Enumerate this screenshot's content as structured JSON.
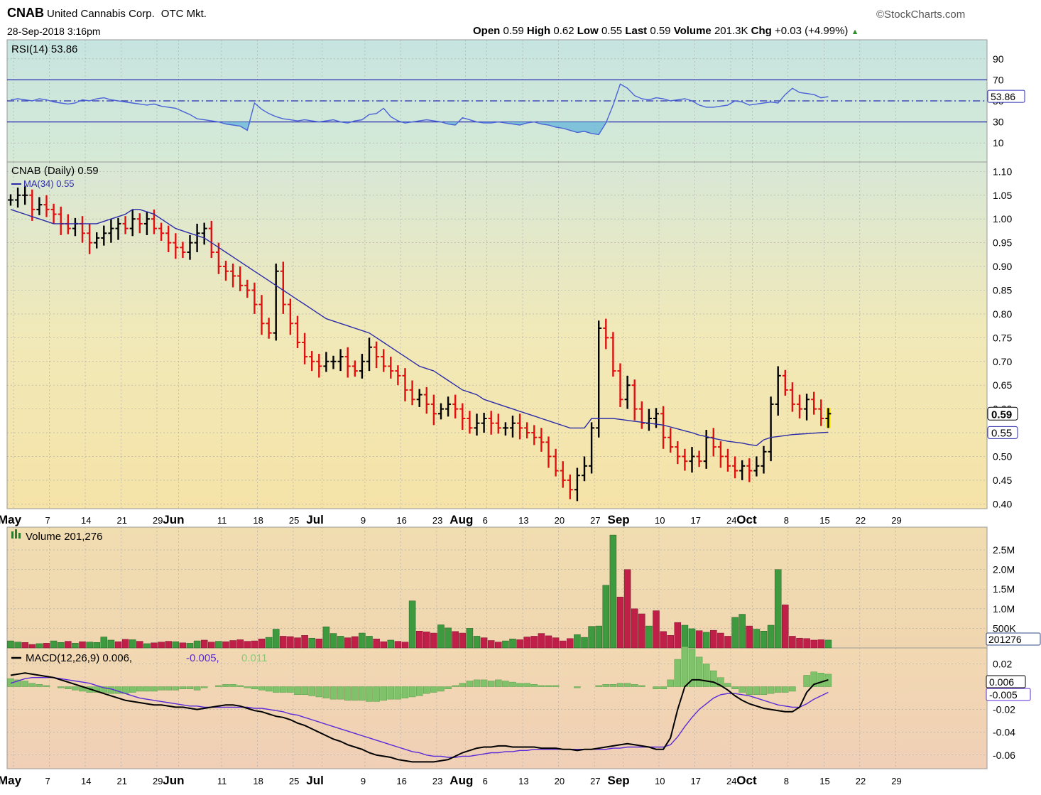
{
  "header": {
    "symbol": "CNAB",
    "company": "United Cannabis Corp.",
    "exchange": "OTC Mkt.",
    "datetime": "28-Sep-2018 3:16pm",
    "brand": "©StockCharts.com",
    "open_label": "Open",
    "open": "0.59",
    "high_label": "High",
    "high": "0.62",
    "low_label": "Low",
    "low": "0.55",
    "last_label": "Last",
    "last": "0.59",
    "volume_label": "Volume",
    "volume": "201.3K",
    "chg_label": "Chg",
    "chg": "+0.03 (+4.99%)"
  },
  "colors": {
    "up": "#000000",
    "down": "#e01010",
    "last_bar": "#f2e600",
    "line": "#2b2ba8",
    "rsi": "#4a62d6",
    "vol_up": "#3e9a3e",
    "vol_down": "#c02048",
    "hist": "#7fc26a",
    "signal": "#5a2ad8"
  },
  "chart_data": [
    {
      "type": "line",
      "title": "RSI(14) 53.86",
      "icon": "rsi-icon",
      "ylim": [
        0,
        100
      ],
      "yticks": [
        "10",
        "30",
        "50",
        "70",
        "90"
      ],
      "guides": [
        30,
        50,
        70
      ],
      "last_label": "53.86",
      "series": [
        {
          "name": "RSI(14)",
          "values": [
            51,
            52,
            51,
            50,
            52,
            51,
            49,
            48,
            47,
            48,
            51,
            50,
            52,
            53,
            51,
            50,
            49,
            48,
            47,
            46,
            47,
            45,
            44,
            43,
            40,
            37,
            33,
            32,
            31,
            30,
            28,
            27,
            26,
            22,
            48,
            42,
            38,
            35,
            33,
            32,
            31,
            32,
            31,
            30,
            31,
            32,
            30,
            29,
            31,
            32,
            37,
            38,
            43,
            35,
            31,
            29,
            30,
            31,
            32,
            31,
            30,
            28,
            27,
            34,
            32,
            30,
            29,
            29,
            30,
            29,
            28,
            27,
            29,
            30,
            28,
            27,
            25,
            24,
            22,
            20,
            21,
            19,
            18,
            29,
            46,
            66,
            62,
            55,
            52,
            51,
            53,
            52,
            50,
            51,
            52,
            50,
            46,
            44,
            44,
            45,
            46,
            50,
            49,
            46,
            47,
            48,
            49,
            48,
            56,
            62,
            58,
            57,
            56,
            53,
            54
          ]
        }
      ]
    },
    {
      "type": "bar",
      "subtype": "ohlc",
      "title": "CNAB (Daily) 0.59",
      "ma_label": "MA(34) 0.55",
      "ylim": [
        0.39,
        1.12
      ],
      "yticks": [
        "0.40",
        "0.45",
        "0.50",
        "0.55",
        "0.60",
        "0.65",
        "0.70",
        "0.75",
        "0.80",
        "0.85",
        "0.90",
        "0.95",
        "1.00",
        "1.05",
        "1.10"
      ],
      "last_price_label": "0.59",
      "ma_last_label": "0.55",
      "x_ticks": [
        "May",
        "7",
        "14",
        "21",
        "29",
        "Jun",
        "11",
        "18",
        "25",
        "Jul",
        "9",
        "16",
        "23",
        "Aug",
        "6",
        "13",
        "20",
        "27",
        "Sep",
        "10",
        "17",
        "24",
        "Oct",
        "8",
        "15",
        "22",
        "29"
      ],
      "close": [
        1.04,
        1.05,
        1.05,
        1.02,
        1.03,
        1.02,
        1.01,
        0.99,
        0.98,
        0.99,
        0.97,
        0.95,
        0.96,
        0.97,
        0.98,
        0.99,
        0.98,
        1.0,
        0.99,
        1.0,
        0.98,
        0.97,
        0.95,
        0.94,
        0.93,
        0.95,
        0.97,
        0.98,
        0.93,
        0.9,
        0.89,
        0.88,
        0.86,
        0.85,
        0.82,
        0.78,
        0.76,
        0.89,
        0.82,
        0.78,
        0.74,
        0.71,
        0.7,
        0.69,
        0.7,
        0.7,
        0.71,
        0.69,
        0.68,
        0.7,
        0.73,
        0.71,
        0.69,
        0.68,
        0.67,
        0.64,
        0.62,
        0.63,
        0.61,
        0.59,
        0.6,
        0.61,
        0.6,
        0.58,
        0.56,
        0.57,
        0.58,
        0.57,
        0.56,
        0.56,
        0.57,
        0.56,
        0.55,
        0.54,
        0.53,
        0.5,
        0.47,
        0.45,
        0.43,
        0.46,
        0.48,
        0.56,
        0.77,
        0.75,
        0.68,
        0.62,
        0.65,
        0.6,
        0.57,
        0.58,
        0.59,
        0.54,
        0.52,
        0.5,
        0.49,
        0.5,
        0.49,
        0.54,
        0.52,
        0.5,
        0.48,
        0.47,
        0.48,
        0.47,
        0.48,
        0.51,
        0.61,
        0.67,
        0.64,
        0.61,
        0.6,
        0.62,
        0.6,
        0.58,
        0.59
      ],
      "ma": [
        1.02,
        1.015,
        1.01,
        1.005,
        1.0,
        0.995,
        0.99,
        0.99,
        0.99,
        0.99,
        0.99,
        0.99,
        0.99,
        0.995,
        1.0,
        1.005,
        1.01,
        1.02,
        1.02,
        1.015,
        1.01,
        1.0,
        0.99,
        0.98,
        0.975,
        0.97,
        0.965,
        0.96,
        0.95,
        0.94,
        0.93,
        0.92,
        0.91,
        0.9,
        0.89,
        0.88,
        0.87,
        0.86,
        0.85,
        0.84,
        0.83,
        0.82,
        0.81,
        0.8,
        0.79,
        0.785,
        0.78,
        0.775,
        0.77,
        0.765,
        0.76,
        0.75,
        0.74,
        0.73,
        0.72,
        0.71,
        0.7,
        0.69,
        0.685,
        0.68,
        0.67,
        0.66,
        0.65,
        0.64,
        0.635,
        0.63,
        0.62,
        0.615,
        0.61,
        0.605,
        0.6,
        0.595,
        0.59,
        0.585,
        0.58,
        0.575,
        0.57,
        0.565,
        0.56,
        0.56,
        0.56,
        0.58,
        0.58,
        0.58,
        0.58,
        0.578,
        0.576,
        0.574,
        0.572,
        0.57,
        0.568,
        0.566,
        0.562,
        0.558,
        0.554,
        0.55,
        0.545,
        0.542,
        0.538,
        0.535,
        0.532,
        0.53,
        0.528,
        0.525,
        0.523,
        0.535,
        0.54,
        0.542,
        0.544,
        0.546,
        0.547,
        0.548,
        0.549,
        0.55,
        0.551
      ]
    },
    {
      "type": "bar",
      "title": "Volume 201,276",
      "icon": "volume-icon",
      "ylim": [
        0,
        2900000
      ],
      "yticks": [
        "500K",
        "1.0M",
        "1.5M",
        "2.0M",
        "2.5M"
      ],
      "last_label": "201276",
      "values": [
        180000,
        150000,
        140000,
        90000,
        110000,
        120000,
        180000,
        140000,
        170000,
        120000,
        160000,
        150000,
        140000,
        280000,
        200000,
        160000,
        220000,
        210000,
        170000,
        110000,
        130000,
        150000,
        170000,
        160000,
        130000,
        120000,
        180000,
        200000,
        150000,
        170000,
        160000,
        190000,
        210000,
        170000,
        180000,
        230000,
        270000,
        480000,
        300000,
        290000,
        260000,
        320000,
        250000,
        230000,
        540000,
        370000,
        300000,
        260000,
        290000,
        380000,
        300000,
        230000,
        160000,
        200000,
        170000,
        150000,
        1200000,
        430000,
        410000,
        380000,
        590000,
        510000,
        420000,
        380000,
        500000,
        300000,
        260000,
        190000,
        150000,
        180000,
        230000,
        210000,
        280000,
        300000,
        370000,
        310000,
        260000,
        180000,
        240000,
        340000,
        270000,
        550000,
        560000,
        1600000,
        2880000,
        1300000,
        2000000,
        1000000,
        870000,
        560000,
        950000,
        420000,
        320000,
        650000,
        580000,
        490000,
        440000,
        400000,
        450000,
        380000,
        300000,
        780000,
        860000,
        560000,
        480000,
        430000,
        580000,
        2000000,
        1100000,
        300000,
        250000,
        240000,
        200000,
        210000,
        201276
      ],
      "up": [
        1,
        1,
        0,
        0,
        1,
        0,
        1,
        1,
        0,
        1,
        0,
        1,
        1,
        1,
        1,
        0,
        0,
        1,
        0,
        1,
        0,
        0,
        0,
        1,
        0,
        1,
        1,
        0,
        0,
        1,
        0,
        0,
        0,
        0,
        0,
        0,
        1,
        1,
        0,
        0,
        0,
        0,
        1,
        0,
        1,
        1,
        1,
        0,
        0,
        1,
        1,
        0,
        0,
        1,
        0,
        0,
        1,
        0,
        0,
        0,
        1,
        1,
        0,
        0,
        1,
        1,
        0,
        0,
        0,
        1,
        1,
        0,
        0,
        0,
        0,
        0,
        0,
        0,
        0,
        1,
        1,
        1,
        1,
        1,
        1,
        0,
        0,
        0,
        0,
        1,
        0,
        0,
        0,
        0,
        1,
        1,
        0,
        1,
        0,
        0,
        0,
        1,
        1,
        0,
        1,
        1,
        1,
        1,
        0,
        0,
        0,
        0,
        0,
        0,
        1
      ]
    },
    {
      "type": "line",
      "title": "MACD(12,26,9) 0.006, -0.005, 0.011",
      "legend": [
        "MACD(12,26,9) 0.006,",
        "-0.005,",
        "0.011"
      ],
      "ylim": [
        -0.072,
        0.034
      ],
      "yticks": [
        "-0.06",
        "-0.04",
        "-0.02",
        "0.02"
      ],
      "last_macd_label": "0.006",
      "last_signal_label": "-0.005",
      "macd": [
        0.01,
        0.011,
        0.012,
        0.011,
        0.01,
        0.009,
        0.008,
        0.006,
        0.004,
        0.002,
        0.0,
        -0.002,
        -0.004,
        -0.006,
        -0.008,
        -0.01,
        -0.012,
        -0.013,
        -0.014,
        -0.015,
        -0.016,
        -0.016,
        -0.017,
        -0.018,
        -0.018,
        -0.019,
        -0.02,
        -0.019,
        -0.018,
        -0.017,
        -0.016,
        -0.016,
        -0.017,
        -0.019,
        -0.021,
        -0.022,
        -0.024,
        -0.026,
        -0.027,
        -0.029,
        -0.032,
        -0.034,
        -0.037,
        -0.04,
        -0.043,
        -0.046,
        -0.048,
        -0.051,
        -0.053,
        -0.055,
        -0.058,
        -0.06,
        -0.061,
        -0.062,
        -0.064,
        -0.065,
        -0.066,
        -0.066,
        -0.066,
        -0.066,
        -0.065,
        -0.064,
        -0.061,
        -0.058,
        -0.056,
        -0.054,
        -0.053,
        -0.053,
        -0.052,
        -0.052,
        -0.053,
        -0.053,
        -0.053,
        -0.053,
        -0.054,
        -0.054,
        -0.054,
        -0.055,
        -0.055,
        -0.056,
        -0.055,
        -0.055,
        -0.054,
        -0.053,
        -0.052,
        -0.051,
        -0.05,
        -0.051,
        -0.052,
        -0.053,
        -0.055,
        -0.055,
        -0.045,
        -0.02,
        0.0,
        0.006,
        0.006,
        0.005,
        0.004,
        0.001,
        -0.003,
        -0.008,
        -0.012,
        -0.015,
        -0.017,
        -0.019,
        -0.02,
        -0.021,
        -0.022,
        -0.022,
        -0.018,
        -0.005,
        0.002,
        0.004,
        0.006
      ],
      "signal": [
        0.003,
        0.005,
        0.007,
        0.008,
        0.008,
        0.008,
        0.008,
        0.007,
        0.006,
        0.005,
        0.004,
        0.003,
        0.001,
        -0.001,
        -0.002,
        -0.004,
        -0.006,
        -0.008,
        -0.01,
        -0.011,
        -0.012,
        -0.013,
        -0.014,
        -0.015,
        -0.016,
        -0.017,
        -0.017,
        -0.018,
        -0.018,
        -0.018,
        -0.018,
        -0.018,
        -0.018,
        -0.018,
        -0.019,
        -0.019,
        -0.02,
        -0.021,
        -0.022,
        -0.024,
        -0.025,
        -0.027,
        -0.029,
        -0.031,
        -0.033,
        -0.035,
        -0.037,
        -0.039,
        -0.041,
        -0.043,
        -0.045,
        -0.047,
        -0.049,
        -0.051,
        -0.053,
        -0.055,
        -0.057,
        -0.058,
        -0.06,
        -0.061,
        -0.061,
        -0.062,
        -0.062,
        -0.061,
        -0.061,
        -0.06,
        -0.059,
        -0.058,
        -0.058,
        -0.057,
        -0.057,
        -0.056,
        -0.056,
        -0.055,
        -0.055,
        -0.055,
        -0.055,
        -0.055,
        -0.055,
        -0.055,
        -0.055,
        -0.055,
        -0.055,
        -0.055,
        -0.054,
        -0.054,
        -0.053,
        -0.053,
        -0.053,
        -0.053,
        -0.053,
        -0.053,
        -0.051,
        -0.044,
        -0.035,
        -0.027,
        -0.02,
        -0.015,
        -0.01,
        -0.007,
        -0.006,
        -0.006,
        -0.007,
        -0.008,
        -0.01,
        -0.012,
        -0.014,
        -0.016,
        -0.017,
        -0.018,
        -0.018,
        -0.015,
        -0.011,
        -0.008,
        -0.005
      ]
    }
  ]
}
